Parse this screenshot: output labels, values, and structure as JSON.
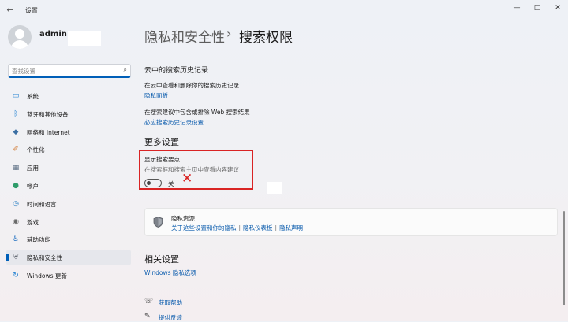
{
  "window": {
    "title": "设置",
    "back_icon": "←",
    "minimize_icon": "—",
    "maximize_icon": "□",
    "close_icon": "✕"
  },
  "profile": {
    "name": "admin"
  },
  "search": {
    "placeholder": "查找设置",
    "icon": "⌕"
  },
  "nav": {
    "items": [
      {
        "label": "系统",
        "icon": "monitor",
        "color": "#1e7fd1"
      },
      {
        "label": "蓝牙和其他设备",
        "icon": "bluetooth",
        "color": "#1e7fd1"
      },
      {
        "label": "网络和 Internet",
        "icon": "wifi",
        "color": "#3b6fa3"
      },
      {
        "label": "个性化",
        "icon": "brush",
        "color": "#d07830"
      },
      {
        "label": "应用",
        "icon": "apps",
        "color": "#5a6c82"
      },
      {
        "label": "帐户",
        "icon": "person",
        "color": "#2e9c6a"
      },
      {
        "label": "时间和语言",
        "icon": "globe-clock",
        "color": "#2a7fc4"
      },
      {
        "label": "游戏",
        "icon": "gamepad",
        "color": "#6a6a6a"
      },
      {
        "label": "辅助功能",
        "icon": "accessibility",
        "color": "#1e6fc0"
      },
      {
        "label": "隐私和安全性",
        "icon": "shield",
        "color": "#6a6f78",
        "active": true
      },
      {
        "label": "Windows 更新",
        "icon": "update",
        "color": "#1e7fd1"
      }
    ]
  },
  "breadcrumb": {
    "parent": "隐私和安全性",
    "separator": "›",
    "current": "搜索权限"
  },
  "cloud_history": {
    "title": "云中的搜索历史记录",
    "row1_text": "在云中查看和删除你的搜索历史记录",
    "row1_link": "隐私面板",
    "row2_text": "在搜索建议中包含或排除 Web 搜索结果",
    "row2_link": "必应搜索历史记录设置"
  },
  "more_settings": {
    "title": "更多设置",
    "highlight_title": "显示搜索要点",
    "highlight_desc": "在搜索框和搜索主页中查看内容建议",
    "toggle_state": "关",
    "toggle_on": false,
    "annotation_mark": "✕"
  },
  "privacy_resources": {
    "title": "隐私资源",
    "links": [
      "关于这些设置和你的隐私",
      "隐私仪表板",
      "隐私声明"
    ],
    "separator": "|"
  },
  "related": {
    "title": "相关设置",
    "link": "Windows 隐私选项"
  },
  "help": {
    "get_help": "获取帮助",
    "feedback": "提供反馈"
  },
  "colors": {
    "accent": "#005fb8",
    "link": "#0b5cad",
    "annotation": "#d92424"
  }
}
